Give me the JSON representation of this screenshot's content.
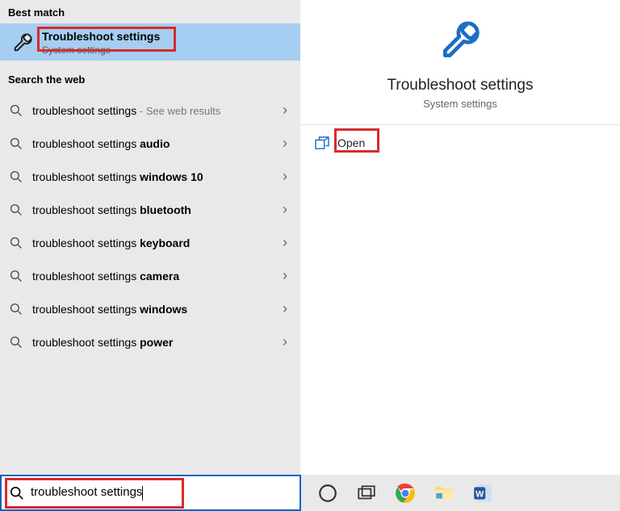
{
  "sections": {
    "best_match_header": "Best match",
    "search_web_header": "Search the web"
  },
  "best_match": {
    "title": "Troubleshoot settings",
    "subtitle": "System settings"
  },
  "web_results": [
    {
      "prefix": "troubleshoot settings",
      "bold": "",
      "suffix": " - See web results"
    },
    {
      "prefix": "troubleshoot settings ",
      "bold": "audio",
      "suffix": ""
    },
    {
      "prefix": "troubleshoot settings ",
      "bold": "windows 10",
      "suffix": ""
    },
    {
      "prefix": "troubleshoot settings ",
      "bold": "bluetooth",
      "suffix": ""
    },
    {
      "prefix": "troubleshoot settings ",
      "bold": "keyboard",
      "suffix": ""
    },
    {
      "prefix": "troubleshoot settings ",
      "bold": "camera",
      "suffix": ""
    },
    {
      "prefix": "troubleshoot settings ",
      "bold": "windows",
      "suffix": ""
    },
    {
      "prefix": "troubleshoot settings ",
      "bold": "power",
      "suffix": ""
    }
  ],
  "detail": {
    "title": "Troubleshoot settings",
    "subtitle": "System settings",
    "open_label": "Open"
  },
  "search": {
    "value": "troubleshoot settings"
  }
}
